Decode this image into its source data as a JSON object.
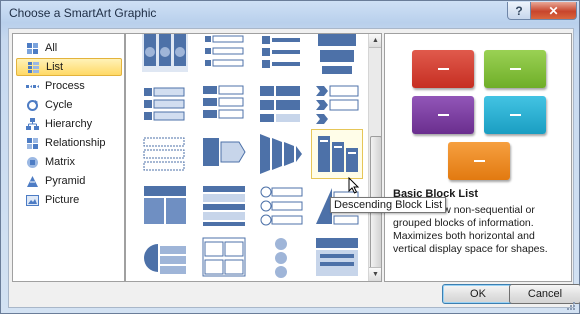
{
  "window": {
    "title": "Choose a SmartArt Graphic",
    "help": "?",
    "close": "✕"
  },
  "categories": [
    {
      "label": "All",
      "icon": "all-icon"
    },
    {
      "label": "List",
      "icon": "list-icon",
      "selected": true
    },
    {
      "label": "Process",
      "icon": "process-icon"
    },
    {
      "label": "Cycle",
      "icon": "cycle-icon"
    },
    {
      "label": "Hierarchy",
      "icon": "hierarchy-icon"
    },
    {
      "label": "Relationship",
      "icon": "relationship-icon"
    },
    {
      "label": "Matrix",
      "icon": "matrix-icon"
    },
    {
      "label": "Pyramid",
      "icon": "pyramid-icon"
    },
    {
      "label": "Picture",
      "icon": "picture-icon"
    }
  ],
  "gallery": {
    "selected_layout": "Descending Block List",
    "tooltip": "Descending Block List"
  },
  "preview": {
    "title": "Basic Block List",
    "description": "Use to show non-sequential or grouped blocks of information. Maximizes both horizontal and vertical display space for shapes.",
    "colors": [
      "#d13c2f",
      "#86c33a",
      "#7b3fa0",
      "#27b4d6",
      "#f08a1c"
    ]
  },
  "buttons": {
    "ok": "OK",
    "cancel": "Cancel"
  }
}
